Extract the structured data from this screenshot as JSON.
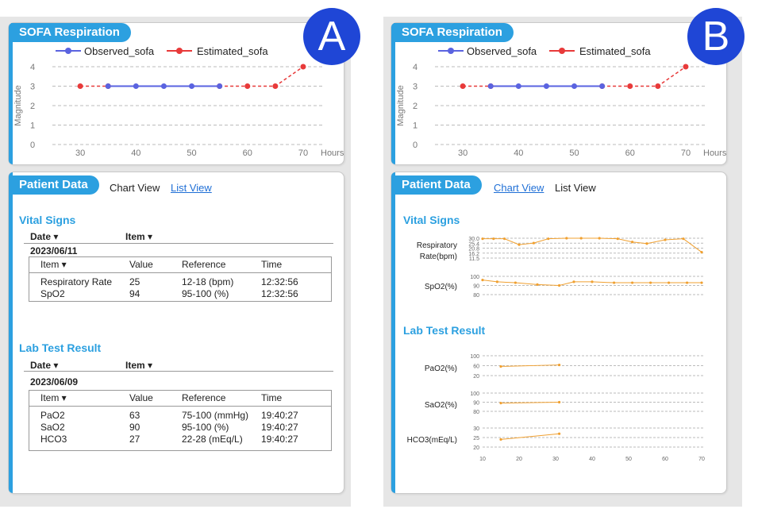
{
  "colors": {
    "accent": "#2ca0e0",
    "observed": "#5a63e0",
    "estimated": "#e83a3a",
    "badge": "#1f46d6",
    "mini_line": "#f0a030",
    "link": "#1f6fd6"
  },
  "panels": [
    {
      "badge": "A",
      "sofa": {
        "title": "SOFA Respiration",
        "legend_observed": "Observed_sofa",
        "legend_estimated": "Estimated_sofa",
        "ylabel": "Magnitude",
        "xunit": "Hours"
      },
      "patient": {
        "title": "Patient Data",
        "view_first": "Chart View",
        "view_second": "List View",
        "active": "List View"
      },
      "vital": {
        "title": "Vital Signs",
        "head_date": "Date ▾",
        "head_item": "Item ▾",
        "date": "2023/06/11",
        "cols": [
          "Item ▾",
          "Value",
          "Reference",
          "Time"
        ],
        "rows": [
          [
            "Respiratory Rate",
            "25",
            "12-18 (bpm)",
            "12:32:56"
          ],
          [
            "SpO2",
            "94",
            "95-100 (%)",
            "12:32:56"
          ]
        ]
      },
      "lab": {
        "title": "Lab Test Result",
        "head_date": "Date ▾",
        "head_item": "Item ▾",
        "date": "2023/06/09",
        "cols": [
          "Item ▾",
          "Value",
          "Reference",
          "Time"
        ],
        "rows": [
          [
            "PaO2",
            "63",
            "75-100 (mmHg)",
            "19:40:27"
          ],
          [
            "SaO2",
            "90",
            "95-100 (%)",
            "19:40:27"
          ],
          [
            "HCO3",
            "27",
            "22-28 (mEq/L)",
            "19:40:27"
          ]
        ]
      }
    },
    {
      "badge": "B",
      "sofa": {
        "title": "SOFA Respiration",
        "legend_observed": "Observed_sofa",
        "legend_estimated": "Estimated_sofa",
        "ylabel": "Magnitude",
        "xunit": "Hours"
      },
      "patient": {
        "title": "Patient Data",
        "view_first": "Chart View",
        "view_second": "List View",
        "active": "Chart View"
      },
      "vital": {
        "title": "Vital Signs"
      },
      "lab": {
        "title": "Lab Test Result"
      }
    }
  ],
  "chart_data": [
    {
      "type": "line",
      "title": "SOFA Respiration",
      "xlabel": "Hours",
      "ylabel": "Magnitude",
      "x_ticks": [
        30,
        40,
        50,
        60,
        70
      ],
      "y_ticks": [
        0,
        1,
        2,
        3,
        4
      ],
      "xlim": [
        25,
        72
      ],
      "ylim": [
        0,
        4
      ],
      "legend": "top",
      "grid": "horizontal dashed",
      "series": [
        {
          "name": "Observed_sofa",
          "x": [
            35,
            40,
            45,
            50,
            55
          ],
          "y": [
            3,
            3,
            3,
            3,
            3
          ]
        },
        {
          "name": "Estimated_sofa",
          "x": [
            30,
            35,
            55,
            60,
            65,
            70
          ],
          "y": [
            3,
            3,
            3,
            3,
            3,
            4
          ]
        }
      ]
    },
    {
      "type": "line",
      "x_ticks": [
        10,
        20,
        30,
        40,
        50,
        60,
        70
      ],
      "xlim": [
        10,
        70
      ],
      "rows": [
        {
          "label": "Respiratory Rate(bpm)",
          "y_ticks": [
            "30.0",
            "25.4",
            "20.8",
            "16.2",
            "11.5"
          ],
          "ylim": [
            11.5,
            30.0
          ],
          "x": [
            10,
            13,
            16,
            20,
            24,
            28,
            33,
            37,
            42,
            47,
            51,
            55,
            60,
            65,
            70
          ],
          "y": [
            29.5,
            29.5,
            29.5,
            24.0,
            25.5,
            29.5,
            30.0,
            30.0,
            30.0,
            29.5,
            26.5,
            25.0,
            28.5,
            29.5,
            17.0
          ]
        },
        {
          "label": "SpO2(%)",
          "y_ticks": [
            "100",
            "90",
            "80"
          ],
          "ylim": [
            80,
            100
          ],
          "x": [
            10,
            14,
            19,
            25,
            31,
            35,
            40,
            46,
            51,
            56,
            61,
            66,
            70
          ],
          "y": [
            96,
            94,
            93,
            91,
            90,
            94,
            94,
            93,
            93,
            93,
            93,
            93,
            93
          ]
        },
        {
          "label": "PaO2(%)",
          "y_ticks": [
            "100",
            "60",
            "20"
          ],
          "ylim": [
            20,
            100
          ],
          "x": [
            15,
            31
          ],
          "y": [
            57,
            63
          ]
        },
        {
          "label": "SaO2(%)",
          "y_ticks": [
            "100",
            "90",
            "80"
          ],
          "ylim": [
            80,
            100
          ],
          "x": [
            15,
            31
          ],
          "y": [
            89,
            90
          ]
        },
        {
          "label": "HCO3(mEq/L)",
          "y_ticks": [
            "30",
            "25",
            "20"
          ],
          "ylim": [
            20,
            30
          ],
          "x": [
            15,
            31
          ],
          "y": [
            24,
            27
          ]
        }
      ]
    }
  ]
}
